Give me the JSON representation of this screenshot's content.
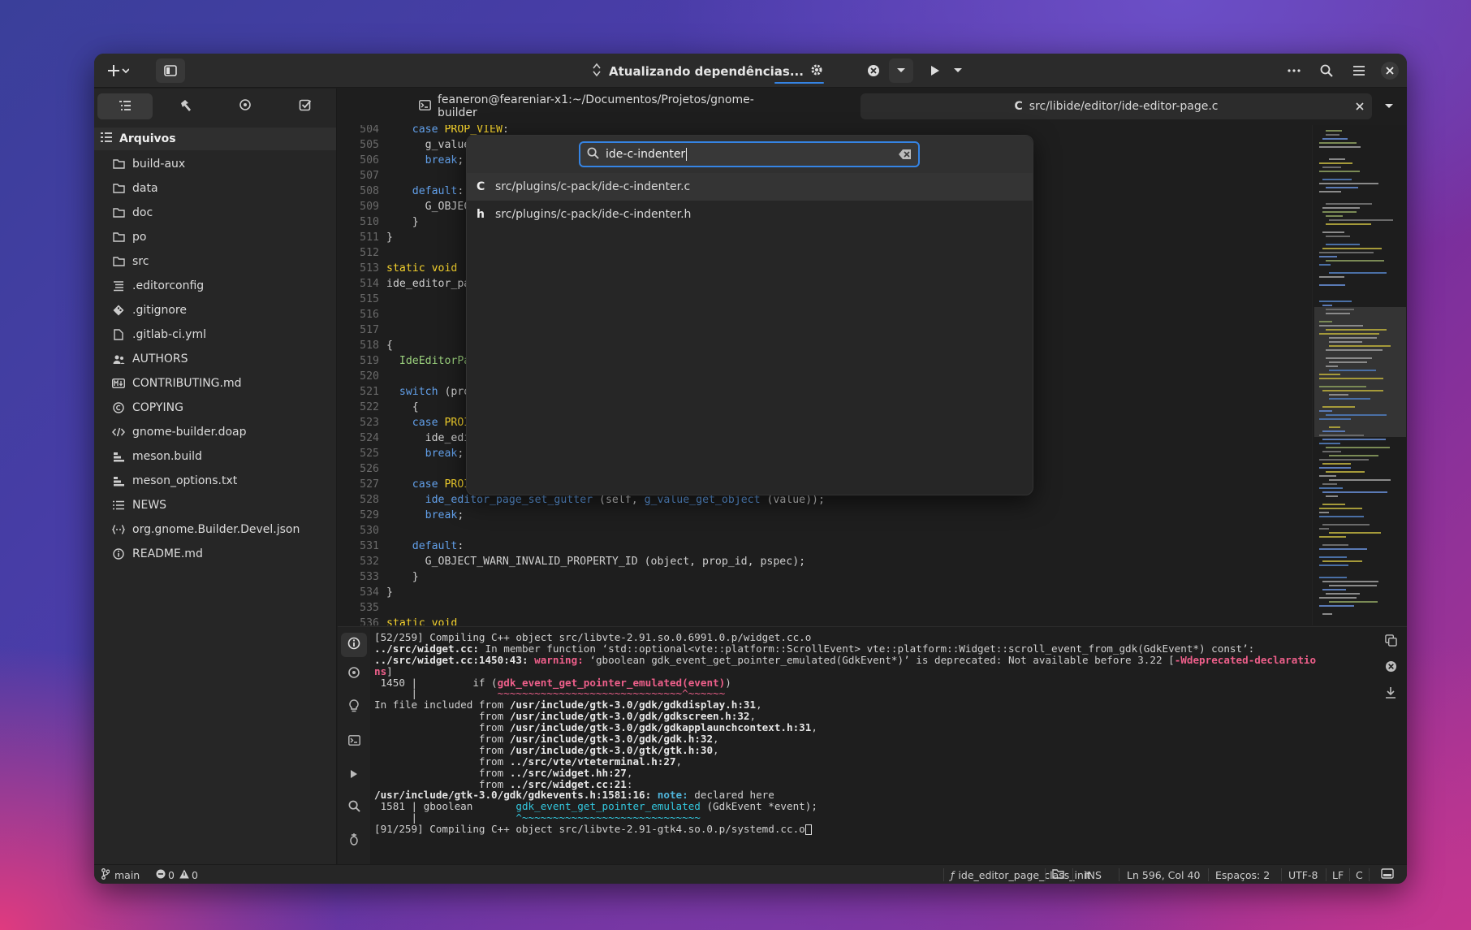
{
  "header": {
    "progress_text": "Atualizando dependências...",
    "icons": [
      "add-icon",
      "sidebar-icon",
      "gear-icon",
      "cancel-icon",
      "run-icon",
      "more-icon",
      "search-icon",
      "menu-icon",
      "close-icon"
    ]
  },
  "sidebar": {
    "tree_title": "Arquivos",
    "items": [
      {
        "label": "build-aux",
        "icon": "folder"
      },
      {
        "label": "data",
        "icon": "folder"
      },
      {
        "label": "doc",
        "icon": "folder"
      },
      {
        "label": "po",
        "icon": "folder"
      },
      {
        "label": "src",
        "icon": "folder"
      },
      {
        "label": ".editorconfig",
        "icon": "config"
      },
      {
        "label": ".gitignore",
        "icon": "git"
      },
      {
        "label": ".gitlab-ci.yml",
        "icon": "file"
      },
      {
        "label": "AUTHORS",
        "icon": "people"
      },
      {
        "label": "CONTRIBUTING.md",
        "icon": "markdown"
      },
      {
        "label": "COPYING",
        "icon": "copyright"
      },
      {
        "label": "gnome-builder.doap",
        "icon": "code"
      },
      {
        "label": "meson.build",
        "icon": "build"
      },
      {
        "label": "meson_options.txt",
        "icon": "build"
      },
      {
        "label": "NEWS",
        "icon": "list"
      },
      {
        "label": "org.gnome.Builder.Devel.json",
        "icon": "json"
      },
      {
        "label": "README.md",
        "icon": "info"
      }
    ]
  },
  "tabs": {
    "terminal": "feaneron@feareniar-x1:~/Documentos/Projetos/gnome-builder",
    "file_type": "C",
    "file": "src/libide/editor/ide-editor-page.c"
  },
  "editor": {
    "lines": [
      {
        "n": "504",
        "code": "    case PROP_VIEW:"
      },
      {
        "n": "505",
        "code": "      g_value"
      },
      {
        "n": "506",
        "code": "      break;"
      },
      {
        "n": "507",
        "code": ""
      },
      {
        "n": "508",
        "code": "    default:"
      },
      {
        "n": "509",
        "code": "      G_OBJEC"
      },
      {
        "n": "510",
        "code": "    }"
      },
      {
        "n": "511",
        "code": "}"
      },
      {
        "n": "512",
        "code": ""
      },
      {
        "n": "513",
        "code": "static void"
      },
      {
        "n": "514",
        "code": "ide_editor_pa"
      },
      {
        "n": "515",
        "code": ""
      },
      {
        "n": "516",
        "code": ""
      },
      {
        "n": "517",
        "code": ""
      },
      {
        "n": "518",
        "code": "{"
      },
      {
        "n": "519",
        "code": "  IdeEditorPa"
      },
      {
        "n": "520",
        "code": ""
      },
      {
        "n": "521",
        "code": "  switch (pro"
      },
      {
        "n": "522",
        "code": "    {"
      },
      {
        "n": "523",
        "code": "    case PROI"
      },
      {
        "n": "524",
        "code": "      ide_edi"
      },
      {
        "n": "525",
        "code": "      break;"
      },
      {
        "n": "526",
        "code": ""
      },
      {
        "n": "527",
        "code": "    case PROI"
      },
      {
        "n": "528",
        "code": "      ide_editor_page_set_gutter (self, g_value_get_object (value));"
      },
      {
        "n": "529",
        "code": "      break;"
      },
      {
        "n": "530",
        "code": ""
      },
      {
        "n": "531",
        "code": "    default:"
      },
      {
        "n": "532",
        "code": "      G_OBJECT_WARN_INVALID_PROPERTY_ID (object, prop_id, pspec);"
      },
      {
        "n": "533",
        "code": "    }"
      },
      {
        "n": "534",
        "code": "}"
      },
      {
        "n": "535",
        "code": ""
      },
      {
        "n": "536",
        "code": "static void"
      }
    ]
  },
  "search": {
    "value": "ide-c-indenter",
    "results": [
      {
        "type": "C",
        "path": "src/plugins/c-pack/ide-c-indenter.c"
      },
      {
        "type": "h",
        "path": "src/plugins/c-pack/ide-c-indenter.h"
      }
    ]
  },
  "terminal_output": {
    "l1": "[52/259] Compiling C++ object src/libvte-2.91.so.0.6991.0.p/widget.cc.o",
    "l2a": "../src/widget.cc:",
    "l2b": " In member function ‘std::optional<vte::platform::ScrollEvent> vte::platform::Widget::scroll_event_from_gdk(GdkEvent*) const’:",
    "l3a": "../src/widget.cc:1450:43: ",
    "l3b": "warning: ",
    "l3c": "‘gboolean gdk_event_get_pointer_emulated(GdkEvent*)’ is deprecated: Not available before 3.22 [",
    "l3d": "-Wdeprecated-declaratio",
    "l4": "ns",
    "l4b": "]",
    "l5a": " 1450 |         if (",
    "l5b": "gdk_event_get_pointer_emulated(event)",
    "l5c": ")",
    "l6a": "      |             ",
    "l6b": "~~~~~~~~~~~~~~~~~~~~~~~~~~~~~~^~~~~~~",
    "l7a": "In file included from ",
    "l7b": "/usr/include/gtk-3.0/gdk/gdkdisplay.h:31",
    "l7c": ",",
    "from_lines": [
      "/usr/include/gtk-3.0/gdk/gdkscreen.h:32",
      "/usr/include/gtk-3.0/gdk/gdkapplaunchcontext.h:31",
      "/usr/include/gtk-3.0/gdk/gdk.h:32",
      "/usr/include/gtk-3.0/gtk/gtk.h:30",
      "../src/vte/vteterminal.h:27",
      "../src/widget.hh:27",
      "../src/widget.cc:21"
    ],
    "from_word": "from",
    "l15a": "/usr/include/gtk-3.0/gdk/gdkevents.h:1581:16: ",
    "l15b": "note: ",
    "l15c": "declared here",
    "l16a": " 1581 | gboolean       ",
    "l16b": "gdk_event_get_pointer_emulated",
    "l16c": " (GdkEvent *event);",
    "l17a": "      |                ",
    "l17b": "^~~~~~~~~~~~~~~~~~~~~~~~~~~~~~",
    "l18": "[91/259] Compiling C++ object src/libvte-2.91-gtk4.so.0.p/systemd.cc.o"
  },
  "status": {
    "branch": "main",
    "errors": "0",
    "warnings": "0",
    "symbol": "ide_editor_page_class_init",
    "mode": "INS",
    "position": "Ln 596, Col 40",
    "indent": "Espaços: 2",
    "encoding": "UTF-8",
    "line_ending": "LF",
    "language": "C"
  },
  "colors": {
    "accent": "#3584e4",
    "warning": "#ed5f8a",
    "note": "#33c7de"
  }
}
